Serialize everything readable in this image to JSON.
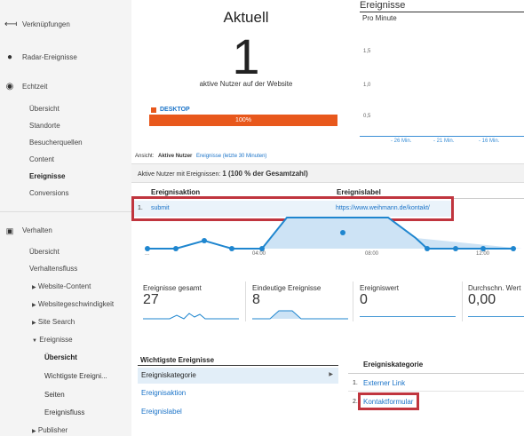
{
  "sidebar": {
    "top_items": [
      {
        "label": "Verknüpfungen",
        "icon": "link-arrow-icon"
      },
      {
        "label": "Radar-Ereignisse",
        "icon": "bulb-icon"
      },
      {
        "label": "Echtzeit",
        "icon": "clock-icon"
      }
    ],
    "realtime_items": [
      "Übersicht",
      "Standorte",
      "Besucherquellen",
      "Content",
      "Ereignisse",
      "Conversions"
    ],
    "realtime_active": "Ereignisse",
    "behavior_label": "Verhalten",
    "behavior_items": [
      "Übersicht",
      "Verhaltensfluss"
    ],
    "behavior_collapsed": [
      "Website-Content",
      "Websitegeschwindigkeit",
      "Site Search"
    ],
    "events_label": "Ereignisse",
    "events_items": [
      "Übersicht",
      "Wichtigste Ereigni...",
      "Seiten",
      "Ereignisfluss"
    ],
    "events_active": "Übersicht",
    "publisher_label": "Publisher"
  },
  "realtime": {
    "title": "Aktuell",
    "count": "1",
    "subtitle": "aktive Nutzer auf der Website",
    "device_label": "DESKTOP",
    "device_percent": "100%",
    "device_share": 1.0,
    "device_color": "#e8581c"
  },
  "events_chart": {
    "title": "Ereignisse",
    "subtitle": "Pro Minute",
    "y_ticks": [
      "1,5",
      "1,0",
      "0,5"
    ],
    "x_ticks": [
      "- 26 Min.",
      "- 21 Min.",
      "- 16 Min."
    ]
  },
  "view": {
    "label": "Ansicht:",
    "active_tab": "Aktive Nutzer",
    "other_tab": "Ereignisse (letzte 30 Minuten)"
  },
  "summary": {
    "prefix": "Aktive Nutzer mit Ereignissen: ",
    "value": "1 (100 % der Gesamtzahl)"
  },
  "event_table": {
    "col1": "Ereignisaktion",
    "col2": "Ereignislabel",
    "rows": [
      {
        "num": "1.",
        "action": "submit",
        "label": "https://www.weihmann.de/kontakt/"
      }
    ]
  },
  "timeline": {
    "x_ticks": [
      "04:00",
      "08:00",
      "12:00"
    ],
    "first_tick": "..."
  },
  "metrics": [
    {
      "label": "Ereignisse gesamt",
      "value": "27"
    },
    {
      "label": "Eindeutige Ereignisse",
      "value": "8"
    },
    {
      "label": "Ereigniswert",
      "value": "0"
    },
    {
      "label": "Durchschn. Wert",
      "value": "0,00"
    }
  ],
  "top_events": {
    "title": "Wichtigste Ereignisse",
    "options": [
      "Ereigniskategorie",
      "Ereignisaktion",
      "Ereignislabel"
    ],
    "selected": "Ereigniskategorie"
  },
  "categories": {
    "header": "Ereigniskategorie",
    "rows": [
      {
        "num": "1.",
        "label": "Externer Link"
      },
      {
        "num": "2.",
        "label": "Kontaktformular"
      }
    ]
  },
  "colors": {
    "accent": "#1a73c8",
    "highlight": "#c0353e",
    "chart": "#1f86cf",
    "device": "#e8581c"
  }
}
